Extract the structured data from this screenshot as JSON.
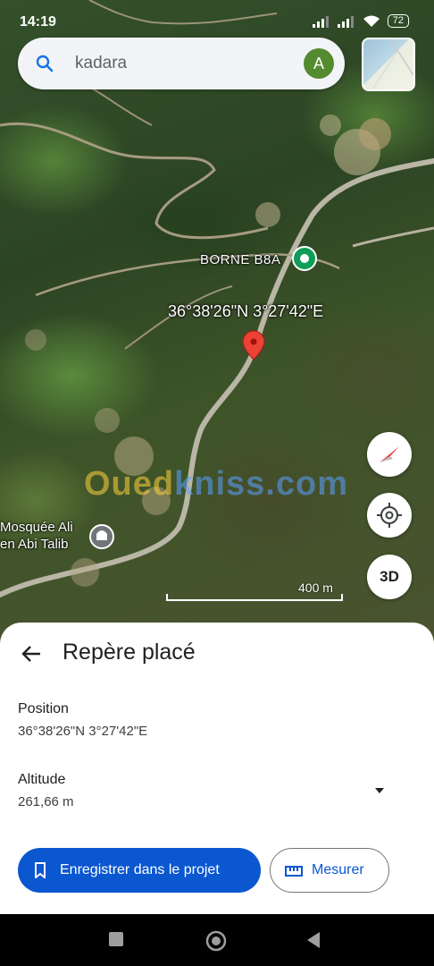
{
  "status_bar": {
    "time": "14:19",
    "battery": "72"
  },
  "search": {
    "text": "kadara",
    "avatar_letter": "A"
  },
  "map": {
    "poi_label": "BORNE B8A",
    "coordinates_label": "36°38'26\"N 3°27'42\"E",
    "mosque_label_line1": "Mosquée Ali",
    "mosque_label_line2": "en Abi Talib",
    "scale_label": "400 m",
    "watermark_part1": "Oued",
    "watermark_part2": "kniss",
    "watermark_part3": ".com",
    "button_3d": "3D",
    "pin_color": "#ea4335"
  },
  "sheet": {
    "title": "Repère placé",
    "position_label": "Position",
    "position_value": "36°38'26\"N 3°27'42\"E",
    "altitude_label": "Altitude",
    "altitude_value": "261,66 m",
    "save_button": "Enregistrer dans le projet",
    "measure_button": "Mesurer"
  },
  "colors": {
    "primary": "#0b57d0",
    "avatar": "#558b2f"
  },
  "icons": [
    "search-icon",
    "back-arrow-icon",
    "bookmark-icon",
    "ruler-icon",
    "compass-icon",
    "my-location-icon",
    "dropdown-arrow-icon",
    "map-pin-icon",
    "recents-icon",
    "home-icon",
    "back-nav-icon"
  ]
}
